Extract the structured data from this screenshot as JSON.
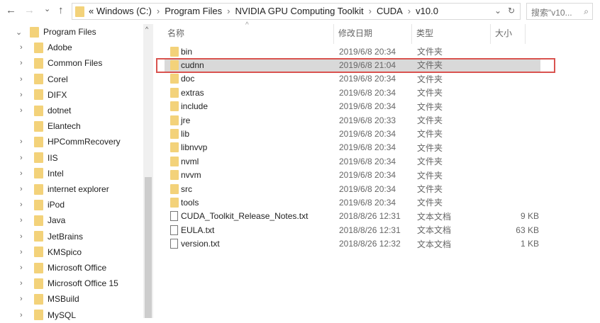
{
  "toolbar": {
    "back": "←",
    "forward": "→",
    "recent": "⌄",
    "up": "↑",
    "breadcrumbs": [
      "Windows (C:)",
      "Program Files",
      "NVIDIA GPU Computing Toolkit",
      "CUDA",
      "v10.0"
    ],
    "overflow": "«",
    "refresh": "↻",
    "dropdown": "⌄",
    "search_placeholder": "搜索\"v10...",
    "search_icon": "⌕"
  },
  "tree": {
    "root": "Program Files",
    "items": [
      "Adobe",
      "Common Files",
      "Corel",
      "DIFX",
      "dotnet",
      "Elantech",
      "HPCommRecovery",
      "IIS",
      "Intel",
      "internet explorer",
      "iPod",
      "Java",
      "JetBrains",
      "KMSpico",
      "Microsoft Office",
      "Microsoft Office 15",
      "MSBuild",
      "MySQL"
    ]
  },
  "columns": {
    "name": "名称",
    "date": "修改日期",
    "type": "类型",
    "size": "大小"
  },
  "files": [
    {
      "name": "bin",
      "date": "2019/6/8 20:34",
      "type": "文件夹",
      "size": "",
      "kind": "folder"
    },
    {
      "name": "cudnn",
      "date": "2019/6/8 21:04",
      "type": "文件夹",
      "size": "",
      "kind": "folder",
      "selected": true
    },
    {
      "name": "doc",
      "date": "2019/6/8 20:34",
      "type": "文件夹",
      "size": "",
      "kind": "folder"
    },
    {
      "name": "extras",
      "date": "2019/6/8 20:34",
      "type": "文件夹",
      "size": "",
      "kind": "folder"
    },
    {
      "name": "include",
      "date": "2019/6/8 20:34",
      "type": "文件夹",
      "size": "",
      "kind": "folder"
    },
    {
      "name": "jre",
      "date": "2019/6/8 20:33",
      "type": "文件夹",
      "size": "",
      "kind": "folder"
    },
    {
      "name": "lib",
      "date": "2019/6/8 20:34",
      "type": "文件夹",
      "size": "",
      "kind": "folder"
    },
    {
      "name": "libnvvp",
      "date": "2019/6/8 20:34",
      "type": "文件夹",
      "size": "",
      "kind": "folder"
    },
    {
      "name": "nvml",
      "date": "2019/6/8 20:34",
      "type": "文件夹",
      "size": "",
      "kind": "folder"
    },
    {
      "name": "nvvm",
      "date": "2019/6/8 20:34",
      "type": "文件夹",
      "size": "",
      "kind": "folder"
    },
    {
      "name": "src",
      "date": "2019/6/8 20:34",
      "type": "文件夹",
      "size": "",
      "kind": "folder"
    },
    {
      "name": "tools",
      "date": "2019/6/8 20:34",
      "type": "文件夹",
      "size": "",
      "kind": "folder"
    },
    {
      "name": "CUDA_Toolkit_Release_Notes.txt",
      "date": "2018/8/26 12:31",
      "type": "文本文档",
      "size": "9 KB",
      "kind": "doc"
    },
    {
      "name": "EULA.txt",
      "date": "2018/8/26 12:31",
      "type": "文本文档",
      "size": "63 KB",
      "kind": "doc"
    },
    {
      "name": "version.txt",
      "date": "2018/8/26 12:32",
      "type": "文本文档",
      "size": "1 KB",
      "kind": "doc"
    }
  ],
  "colors": {
    "highlight": "#d9534f",
    "selection": "#d9d9d9",
    "folder": "#f3d27a"
  }
}
